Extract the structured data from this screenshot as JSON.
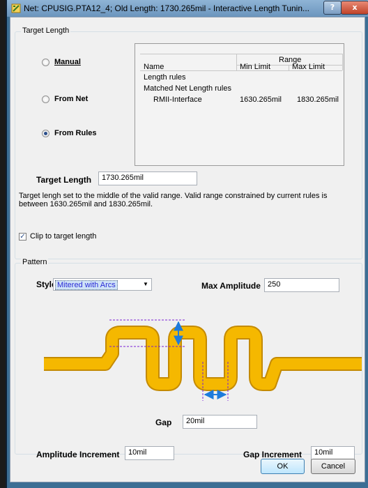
{
  "window": {
    "title": "Net: CPUSIG.PTA12_4;  Old Length: 1730.265mil  -  Interactive Length Tunin...",
    "help_label": "?",
    "close_label": "x"
  },
  "target_length_group": {
    "title": "Target Length",
    "radios": [
      {
        "label": "Manual",
        "selected": false
      },
      {
        "label": "From Net",
        "selected": false
      },
      {
        "label": "From Rules",
        "selected": true
      }
    ],
    "rules_table": {
      "group_header": "Range",
      "col_name": "Name",
      "col_min": "Min Limit",
      "col_max": "Max Limit",
      "rows": [
        {
          "name": "Length rules",
          "min": "",
          "max": ""
        },
        {
          "name": "Matched Net Length rules",
          "min": "",
          "max": ""
        },
        {
          "name": "RMII-Interface",
          "min": "1630.265mil",
          "max": "1830.265mil"
        }
      ]
    },
    "target_length_label": "Target Length",
    "target_length_value": "1730.265mil",
    "description": "Target lengh set to the middle of the valid range. Valid range constrained by current rules is between 1630.265mil and 1830.265mil.",
    "clip_label": "Clip to target length",
    "clip_checked": true
  },
  "pattern_group": {
    "title": "Pattern",
    "style_label": "Style",
    "style_value": "Mitered with Arcs",
    "max_amplitude_label": "Max Amplitude",
    "max_amplitude_value": "250",
    "gap_label": "Gap",
    "gap_value": "20mil",
    "amp_inc_label": "Amplitude Increment",
    "amp_inc_value": "10mil",
    "gap_inc_label": "Gap Increment",
    "gap_inc_value": "10mil"
  },
  "buttons": {
    "ok": "OK",
    "cancel": "Cancel"
  },
  "colors": {
    "trace": "#f5b800",
    "trace_outline": "#c48a00",
    "dimension_arrow": "#1e7bdc",
    "guide_line": "#7a1fd6"
  }
}
